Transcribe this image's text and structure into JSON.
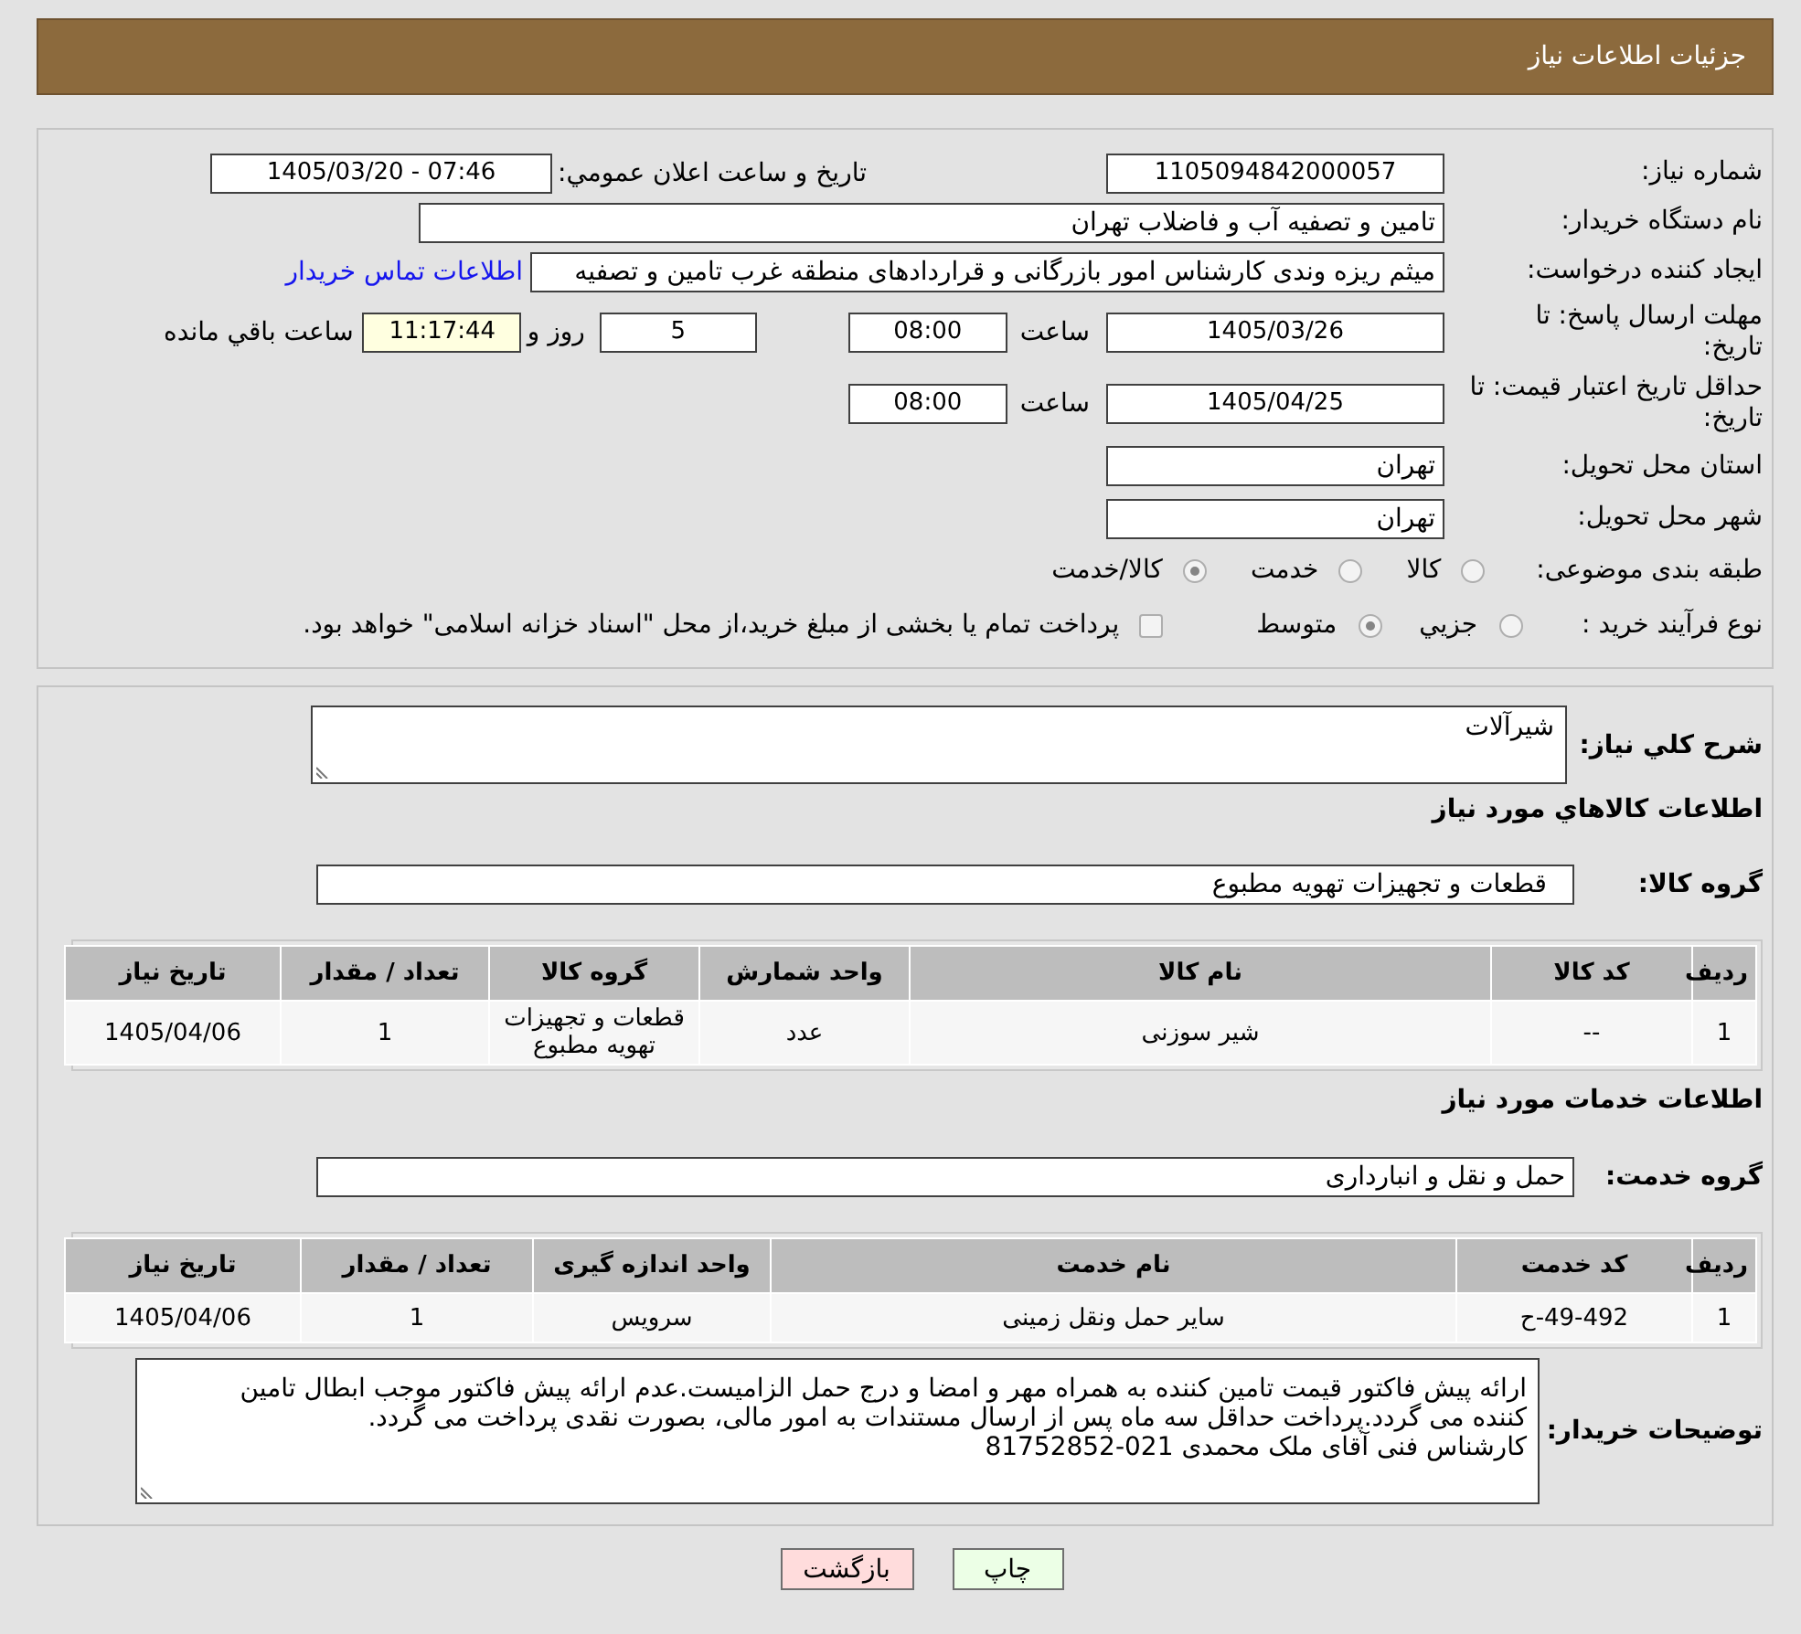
{
  "header": {
    "title": "جزئیات اطلاعات نیاز"
  },
  "details": {
    "need_number": {
      "label": "شماره نیاز:",
      "value": "1105094842000057"
    },
    "announcement": {
      "label": "تاریخ و ساعت اعلان عمومي:",
      "value": "1405/03/20 - 07:46"
    },
    "buyer_org": {
      "label": "نام دستگاه خریدار:",
      "value": "تامین و تصفیه آب و فاضلاب تهران"
    },
    "requester": {
      "label": "ایجاد کننده درخواست:",
      "value": "میثم ریزه وندی کارشناس امور بازرگانی و قراردادهای منطقه غرب تامین و تصفیه",
      "contact_link": "اطلاعات تماس خریدار"
    },
    "reply_deadline": {
      "label": "مهلت ارسال پاسخ: تا تاریخ:",
      "date": "1405/03/26",
      "time_label": "ساعت",
      "time": "08:00",
      "days": "5",
      "days_label": "روز و",
      "remaining": "11:17:44",
      "remaining_label": "ساعت باقي مانده"
    },
    "price_validity": {
      "label": "حداقل تاریخ اعتبار قیمت: تا تاریخ:",
      "date": "1405/04/25",
      "time_label": "ساعت",
      "time": "08:00"
    },
    "province": {
      "label": "استان محل تحویل:",
      "value": "تهران"
    },
    "city": {
      "label": "شهر محل تحویل:",
      "value": "تهران"
    },
    "category": {
      "label": "طبقه بندی موضوعی:",
      "options": [
        {
          "label": "کالا",
          "selected": false
        },
        {
          "label": "خدمت",
          "selected": false
        },
        {
          "label": "کالا/خدمت",
          "selected": true
        }
      ]
    },
    "purchase_process": {
      "label": "نوع فرآیند خرید :",
      "options": [
        {
          "label": "جزيي",
          "selected": false
        },
        {
          "label": "متوسط",
          "selected": true
        }
      ],
      "treasury_payment": {
        "label": "پرداخت تمام یا بخشی از مبلغ خرید،از محل \"اسناد خزانه اسلامی\" خواهد بود.",
        "checked": false
      }
    }
  },
  "needs": {
    "description": {
      "label": "شرح کلي نیاز:",
      "value": "شیرآلات"
    },
    "goods_heading": "اطلاعات کالاهاي مورد نیاز",
    "goods_group": {
      "label": "گروه کالا:",
      "value": "قطعات و تجهیزات تهویه مطبوع"
    },
    "goods_table": {
      "columns": [
        "ردیف",
        "کد کالا",
        "نام کالا",
        "واحد شمارش",
        "گروه کالا",
        "تعداد / مقدار",
        "تاریخ نیاز"
      ],
      "rows": [
        [
          "1",
          "--",
          "شیر سوزنی",
          "عدد",
          "قطعات و تجهیزات تهویه مطبوع",
          "1",
          "1405/04/06"
        ]
      ]
    },
    "services_heading": "اطلاعات خدمات مورد نیاز",
    "service_group": {
      "label": "گروه خدمت:",
      "value": "حمل و نقل و انبارداری"
    },
    "services_table": {
      "columns": [
        "ردیف",
        "کد خدمت",
        "نام خدمت",
        "واحد اندازه گیری",
        "تعداد / مقدار",
        "تاریخ نیاز"
      ],
      "rows": [
        [
          "1",
          "ح-49-492",
          "سایر حمل ونقل زمینی",
          "سرویس",
          "1",
          "1405/04/06"
        ]
      ]
    },
    "notes": {
      "label": "توضیحات خریدار:",
      "value": "ارائه پیش فاکتور قیمت تامین کننده به همراه مهر و امضا و درج حمل الزامیست.عدم ارائه پیش فاکتور موجب ابطال تامین کننده می گردد.پرداخت حداقل سه ماه پس از ارسال مستندات به امور مالی، بصورت نقدی پرداخت می گردد.\nکارشناس فنی آقای ملک محمدی 021-81752852"
    }
  },
  "buttons": [
    {
      "kind": "print",
      "label": "چاپ"
    },
    {
      "kind": "back",
      "label": "بازگشت"
    }
  ]
}
